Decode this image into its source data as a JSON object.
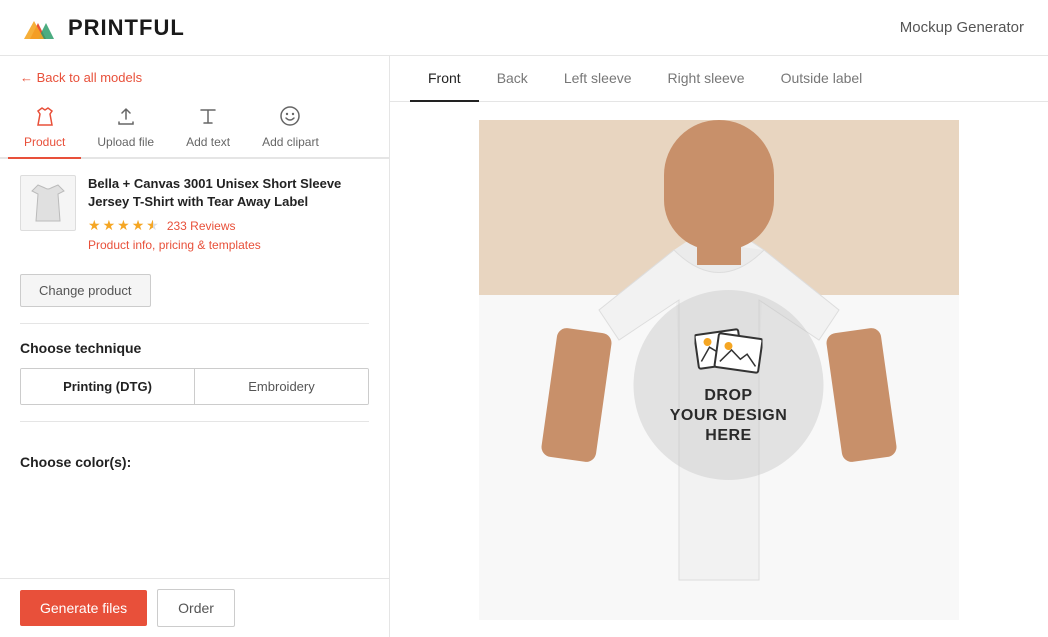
{
  "header": {
    "logo_text": "PRINTFUL",
    "page_title": "Mockup Generator"
  },
  "back_link": "← Back to all models",
  "tabs": [
    {
      "id": "product",
      "label": "Product",
      "icon": "👕",
      "active": true
    },
    {
      "id": "upload",
      "label": "Upload file",
      "icon": "⬆",
      "active": false
    },
    {
      "id": "text",
      "label": "Add text",
      "icon": "T",
      "active": false
    },
    {
      "id": "clipart",
      "label": "Add clipart",
      "icon": "☺",
      "active": false
    }
  ],
  "product": {
    "name": "Bella + Canvas 3001 Unisex Short Sleeve Jersey T-Shirt with Tear Away Label",
    "rating": 4.5,
    "review_count": "233 Reviews",
    "info_link": "Product info, pricing & templates",
    "change_btn": "Change product"
  },
  "technique": {
    "title": "Choose technique",
    "options": [
      "Printing (DTG)",
      "Embroidery"
    ],
    "selected": "Printing (DTG)"
  },
  "color": {
    "title": "Choose color(s):"
  },
  "bottom_bar": {
    "generate_label": "Generate files",
    "order_label": "Order"
  },
  "view_tabs": [
    {
      "id": "front",
      "label": "Front",
      "active": true
    },
    {
      "id": "back",
      "label": "Back",
      "active": false
    },
    {
      "id": "left_sleeve",
      "label": "Left sleeve",
      "active": false
    },
    {
      "id": "right_sleeve",
      "label": "Right sleeve",
      "active": false
    },
    {
      "id": "outside_label",
      "label": "Outside label",
      "active": false
    }
  ],
  "drop_zone": {
    "line1": "DROP",
    "line2": "YOUR DESIGN",
    "line3": "HERE"
  }
}
